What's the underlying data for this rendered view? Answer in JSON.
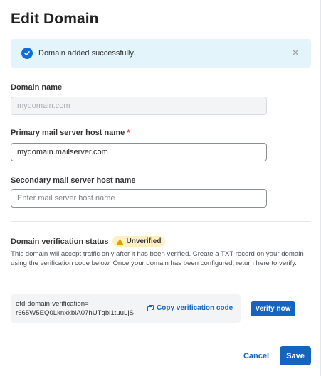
{
  "title": "Edit Domain",
  "alert": {
    "message": "Domain added successfully.",
    "close_symbol": "✕",
    "icon": "check-circle-icon"
  },
  "form": {
    "domain_name_label": "Domain name",
    "domain_name_value": "mydomain.com",
    "primary_label": "Primary mail server host name",
    "primary_required_mark": "*",
    "primary_value": "mydomain.mailserver.com",
    "secondary_label": "Secondary mail server host name",
    "secondary_placeholder": "Enter mail server host name"
  },
  "verification": {
    "status_label": "Domain verification status",
    "badge_text": "Unverified",
    "badge_icon": "warning-icon",
    "description": "This domain will accept traffic only after it has been verified. Create a TXT record on your domain using the verification code below. Once your domain has been configured, return here to verify.",
    "code_line1": "etd-domain-verification=",
    "code_line2": "r665W5EQ0LknxkblA07hUTqbi1tuuLjS",
    "copy_label": "Copy verification code",
    "copy_icon": "copy-icon",
    "verify_label": "Verify now"
  },
  "footer": {
    "cancel_label": "Cancel",
    "save_label": "Save"
  },
  "colors": {
    "accent": "#1565c0",
    "alert_bg": "#e3f4fb",
    "badge_bg": "#fdf0c4",
    "required": "#d93025"
  }
}
